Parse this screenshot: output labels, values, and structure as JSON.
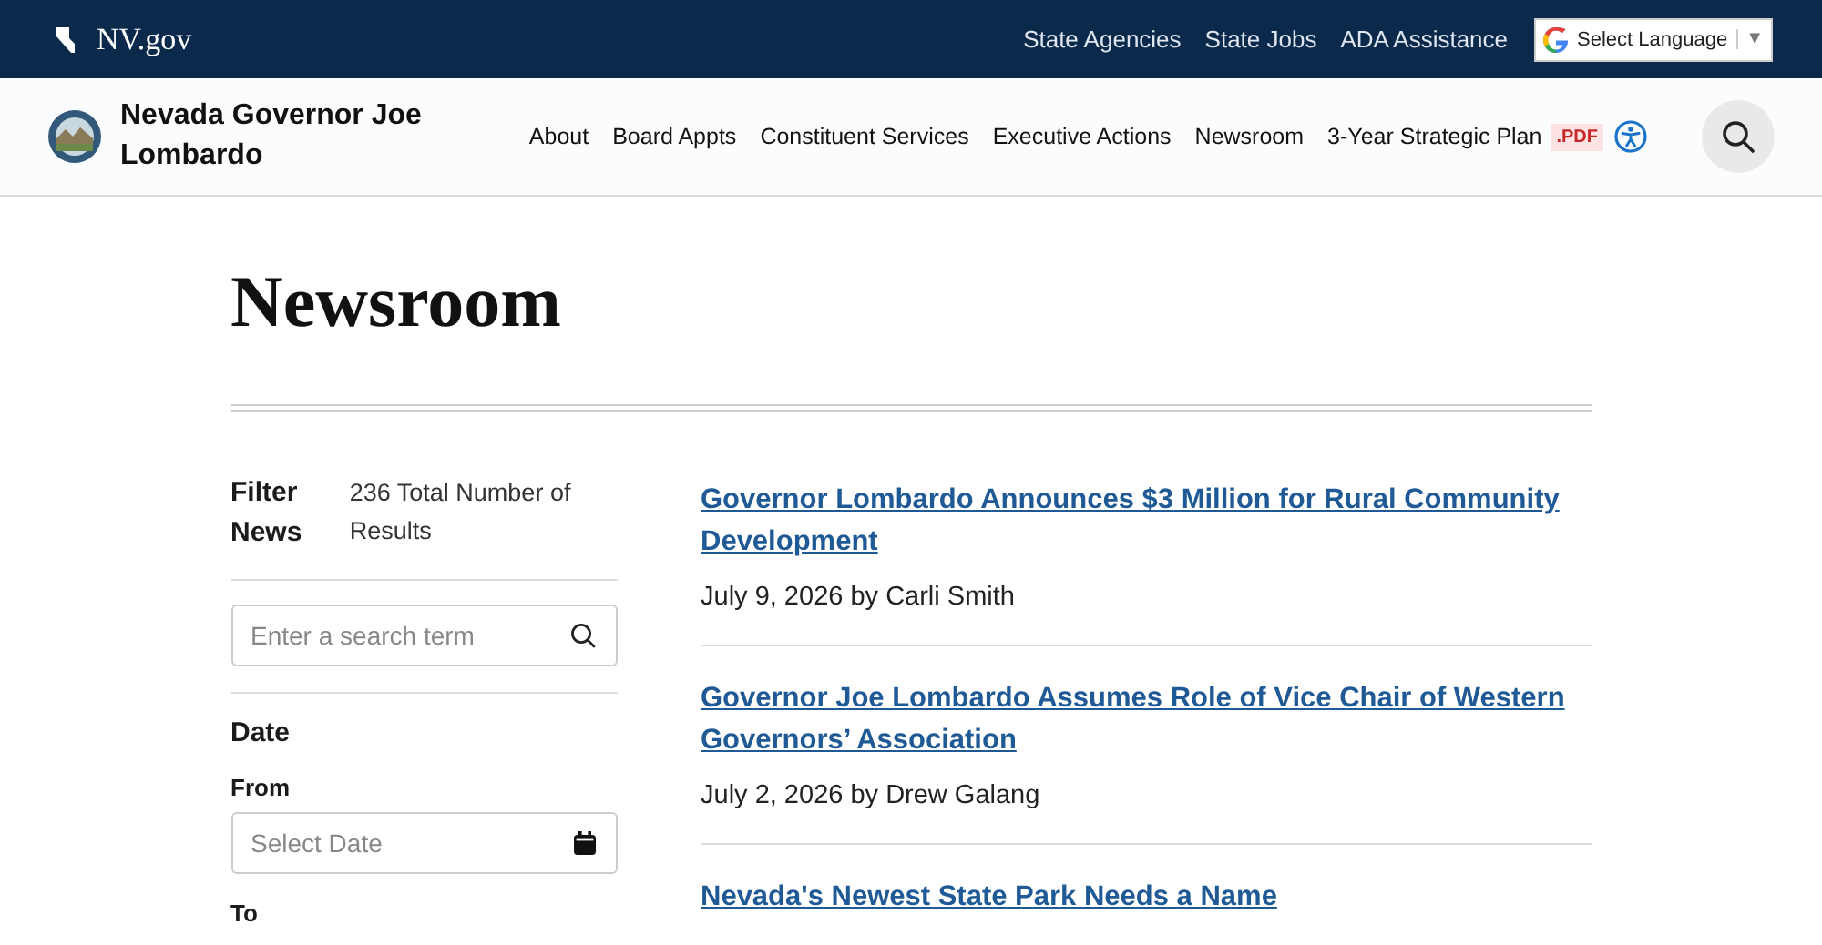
{
  "top_bar": {
    "site": "NV.gov",
    "links": [
      "State Agencies",
      "State Jobs",
      "ADA Assistance"
    ],
    "language_select": "Select Language",
    "language_caret": "▼"
  },
  "header": {
    "title": "Nevada Governor Joe Lombardo",
    "nav": [
      {
        "label": "About"
      },
      {
        "label": "Board Appts"
      },
      {
        "label": "Constituent Services"
      },
      {
        "label": "Executive Actions"
      },
      {
        "label": "Newsroom"
      },
      {
        "label": "3-Year Strategic Plan",
        "badge": ".PDF"
      }
    ]
  },
  "page_title": "Newsroom",
  "filter": {
    "heading": "Filter News",
    "total": "236 Total Number of Results",
    "search": {
      "placeholder": "Enter a search term"
    },
    "date_heading": "Date",
    "from_label": "From",
    "from": {
      "placeholder": "Select Date"
    },
    "to_label": "To"
  },
  "articles": [
    {
      "title": "Governor Lombardo Announces $3 Million for Rural Community Development",
      "byline": "July 9, 2026 by Carli Smith"
    },
    {
      "title": "Governor Joe Lombardo Assumes Role of Vice Chair of Western Governors’ Association",
      "byline": "July 2, 2026 by Drew Galang"
    },
    {
      "title": "Nevada's Newest State Park Needs a Name"
    }
  ]
}
